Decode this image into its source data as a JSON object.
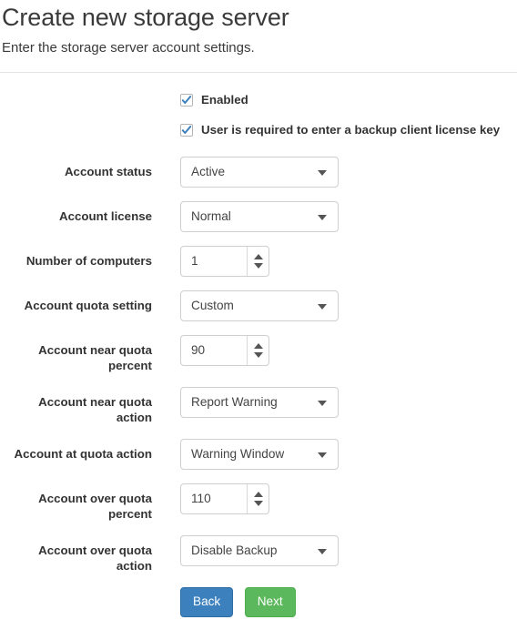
{
  "header": {
    "title": "Create new storage server",
    "subtitle": "Enter the storage server account settings."
  },
  "form": {
    "checkboxes": [
      {
        "label": "Enabled",
        "checked": true,
        "name": "enabled"
      },
      {
        "label": "User is required to enter a backup client license key",
        "checked": true,
        "name": "license-key-required"
      }
    ],
    "fields": [
      {
        "label": "Account status",
        "type": "select",
        "value": "Active",
        "name": "account-status"
      },
      {
        "label": "Account license",
        "type": "select",
        "value": "Normal",
        "name": "account-license"
      },
      {
        "label": "Number of computers",
        "type": "number",
        "value": "1",
        "name": "number-of-computers"
      },
      {
        "label": "Account quota setting",
        "type": "select",
        "value": "Custom",
        "name": "account-quota-setting"
      },
      {
        "label": "Account near quota percent",
        "type": "number",
        "value": "90",
        "name": "account-near-quota-percent"
      },
      {
        "label": "Account near quota action",
        "type": "select",
        "value": "Report Warning",
        "name": "account-near-quota-action"
      },
      {
        "label": "Account at quota action",
        "type": "select",
        "value": "Warning Window",
        "name": "account-at-quota-action"
      },
      {
        "label": "Account over quota percent",
        "type": "number",
        "value": "110",
        "name": "account-over-quota-percent"
      },
      {
        "label": "Account over quota action",
        "type": "select",
        "value": "Disable Backup",
        "name": "account-over-quota-action"
      }
    ],
    "buttons": {
      "back": "Back",
      "next": "Next"
    }
  },
  "colors": {
    "primary": "#3c80bd",
    "success": "#5cb85c",
    "checkmark": "#3c80bd",
    "border": "#cfcfcf",
    "text": "#333333"
  }
}
